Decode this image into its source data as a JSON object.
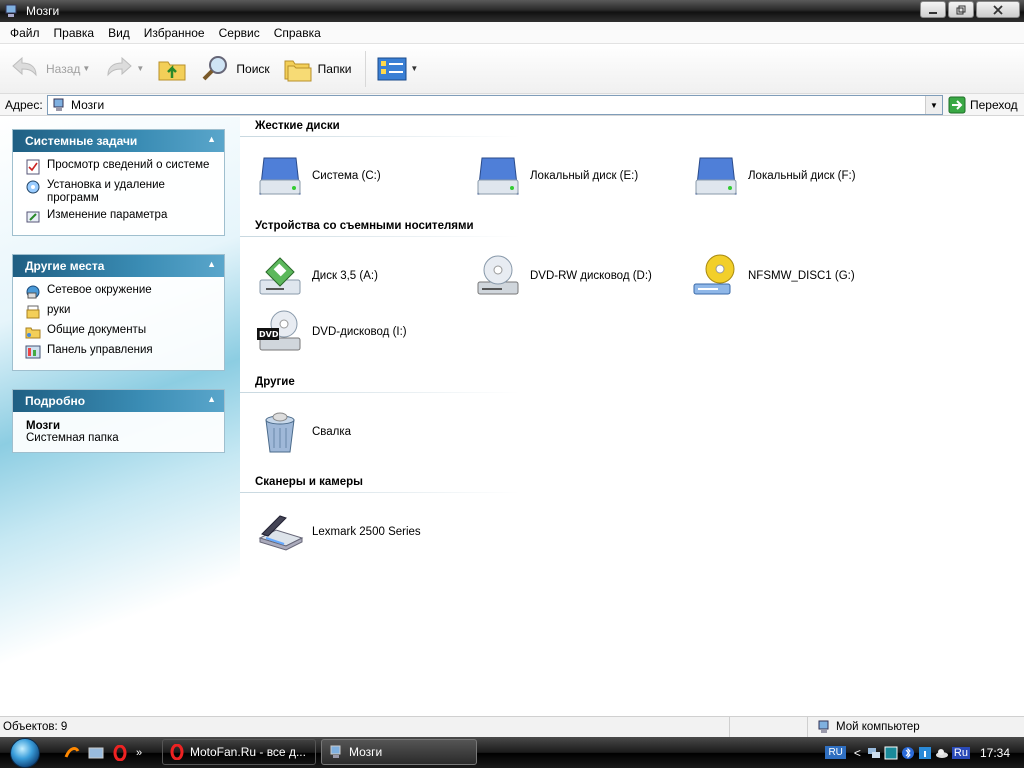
{
  "window": {
    "title": "Мозги"
  },
  "menu": [
    "Файл",
    "Правка",
    "Вид",
    "Избранное",
    "Сервис",
    "Справка"
  ],
  "toolbar": {
    "back": "Назад",
    "search": "Поиск",
    "folders": "Папки"
  },
  "address": {
    "label": "Адрес:",
    "value": "Мозги",
    "go": "Переход"
  },
  "sidebar": {
    "system_tasks": {
      "title": "Системные задачи",
      "items": [
        "Просмотр сведений о системе",
        "Установка и удаление программ",
        "Изменение параметра"
      ]
    },
    "other_places": {
      "title": "Другие места",
      "items": [
        "Сетевое окружение",
        "руки",
        "Общие документы",
        "Панель управления"
      ]
    },
    "details": {
      "title": "Подробно",
      "name": "Мозги",
      "type": "Системная папка"
    }
  },
  "groups": {
    "hard_drives": {
      "title": "Жесткие диски",
      "items": [
        "Система (C:)",
        "Локальный диск (E:)",
        "Локальный диск (F:)"
      ]
    },
    "removable": {
      "title": "Устройства со съемными носителями",
      "items": [
        "Диск 3,5 (A:)",
        "DVD-RW дисковод (D:)",
        "NFSMW_DISC1 (G:)",
        "DVD-дисковод (I:)"
      ]
    },
    "other": {
      "title": "Другие",
      "items": [
        "Свалка"
      ]
    },
    "scanners": {
      "title": "Сканеры и камеры",
      "items": [
        "Lexmark 2500 Series"
      ]
    }
  },
  "status": {
    "objects": "Объектов: 9",
    "location": "Мой компьютер"
  },
  "taskbar": {
    "tasks": [
      "MotoFan.Ru - все д...",
      "Мозги"
    ],
    "lang": "RU",
    "tray_text": "Ru",
    "time": "17:34"
  },
  "colors": {
    "panel_header": "#1f5f83",
    "taskbar": "#1b1b1b"
  }
}
